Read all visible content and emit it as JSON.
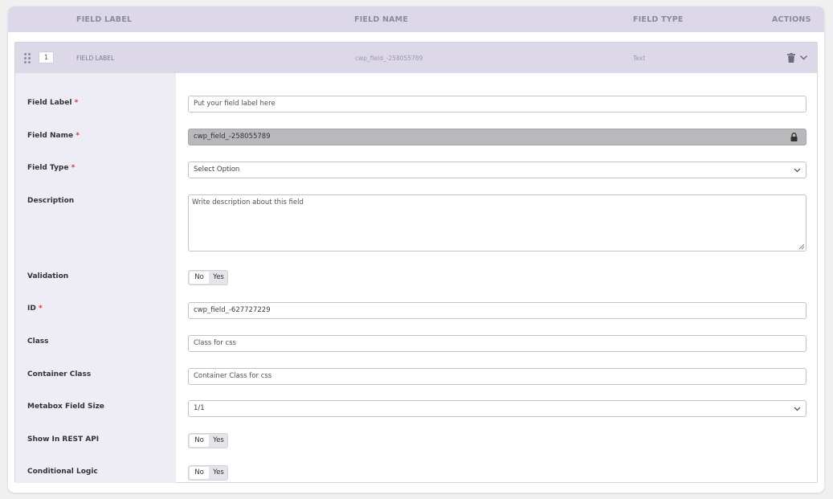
{
  "header": {
    "field_label": "FIELD LABEL",
    "field_name": "FIELD NAME",
    "field_type": "FIELD TYPE",
    "actions": "ACTIONS"
  },
  "row": {
    "order": "1",
    "label": "FIELD LABEL",
    "name": "cwp_field_-258055789",
    "type": "Text"
  },
  "form": {
    "field_label": {
      "label": "Field Label",
      "required": "*",
      "placeholder": "Put your field label here"
    },
    "field_name": {
      "label": "Field Name",
      "required": "*",
      "value": "cwp_field_-258055789"
    },
    "field_type": {
      "label": "Field Type",
      "required": "*",
      "value": "Select Option"
    },
    "description": {
      "label": "Description",
      "placeholder": "Write description about this field"
    },
    "validation": {
      "label": "Validation",
      "no": "No",
      "yes": "Yes"
    },
    "id": {
      "label": "ID",
      "required": "*",
      "value": "cwp_field_-627727229"
    },
    "class": {
      "label": "Class",
      "placeholder": "Class for css"
    },
    "container_class": {
      "label": "Container Class",
      "placeholder": "Container Class for css"
    },
    "metabox_size": {
      "label": "Metabox Field Size",
      "value": "1/1"
    },
    "rest_api": {
      "label": "Show In REST API",
      "no": "No",
      "yes": "Yes"
    },
    "conditional_logic": {
      "label": "Conditional Logic",
      "no": "No",
      "yes": "Yes"
    }
  },
  "icons": {
    "drag": "drag-handle-icon",
    "trash": "trash-icon",
    "chevron": "chevron-down-icon",
    "lock": "lock-icon"
  },
  "colors": {
    "header_bg": "#dcd8e8",
    "sidebar_bg": "#eeecf5",
    "required": "#d63638",
    "disabled_input": "#b9b9bc"
  }
}
